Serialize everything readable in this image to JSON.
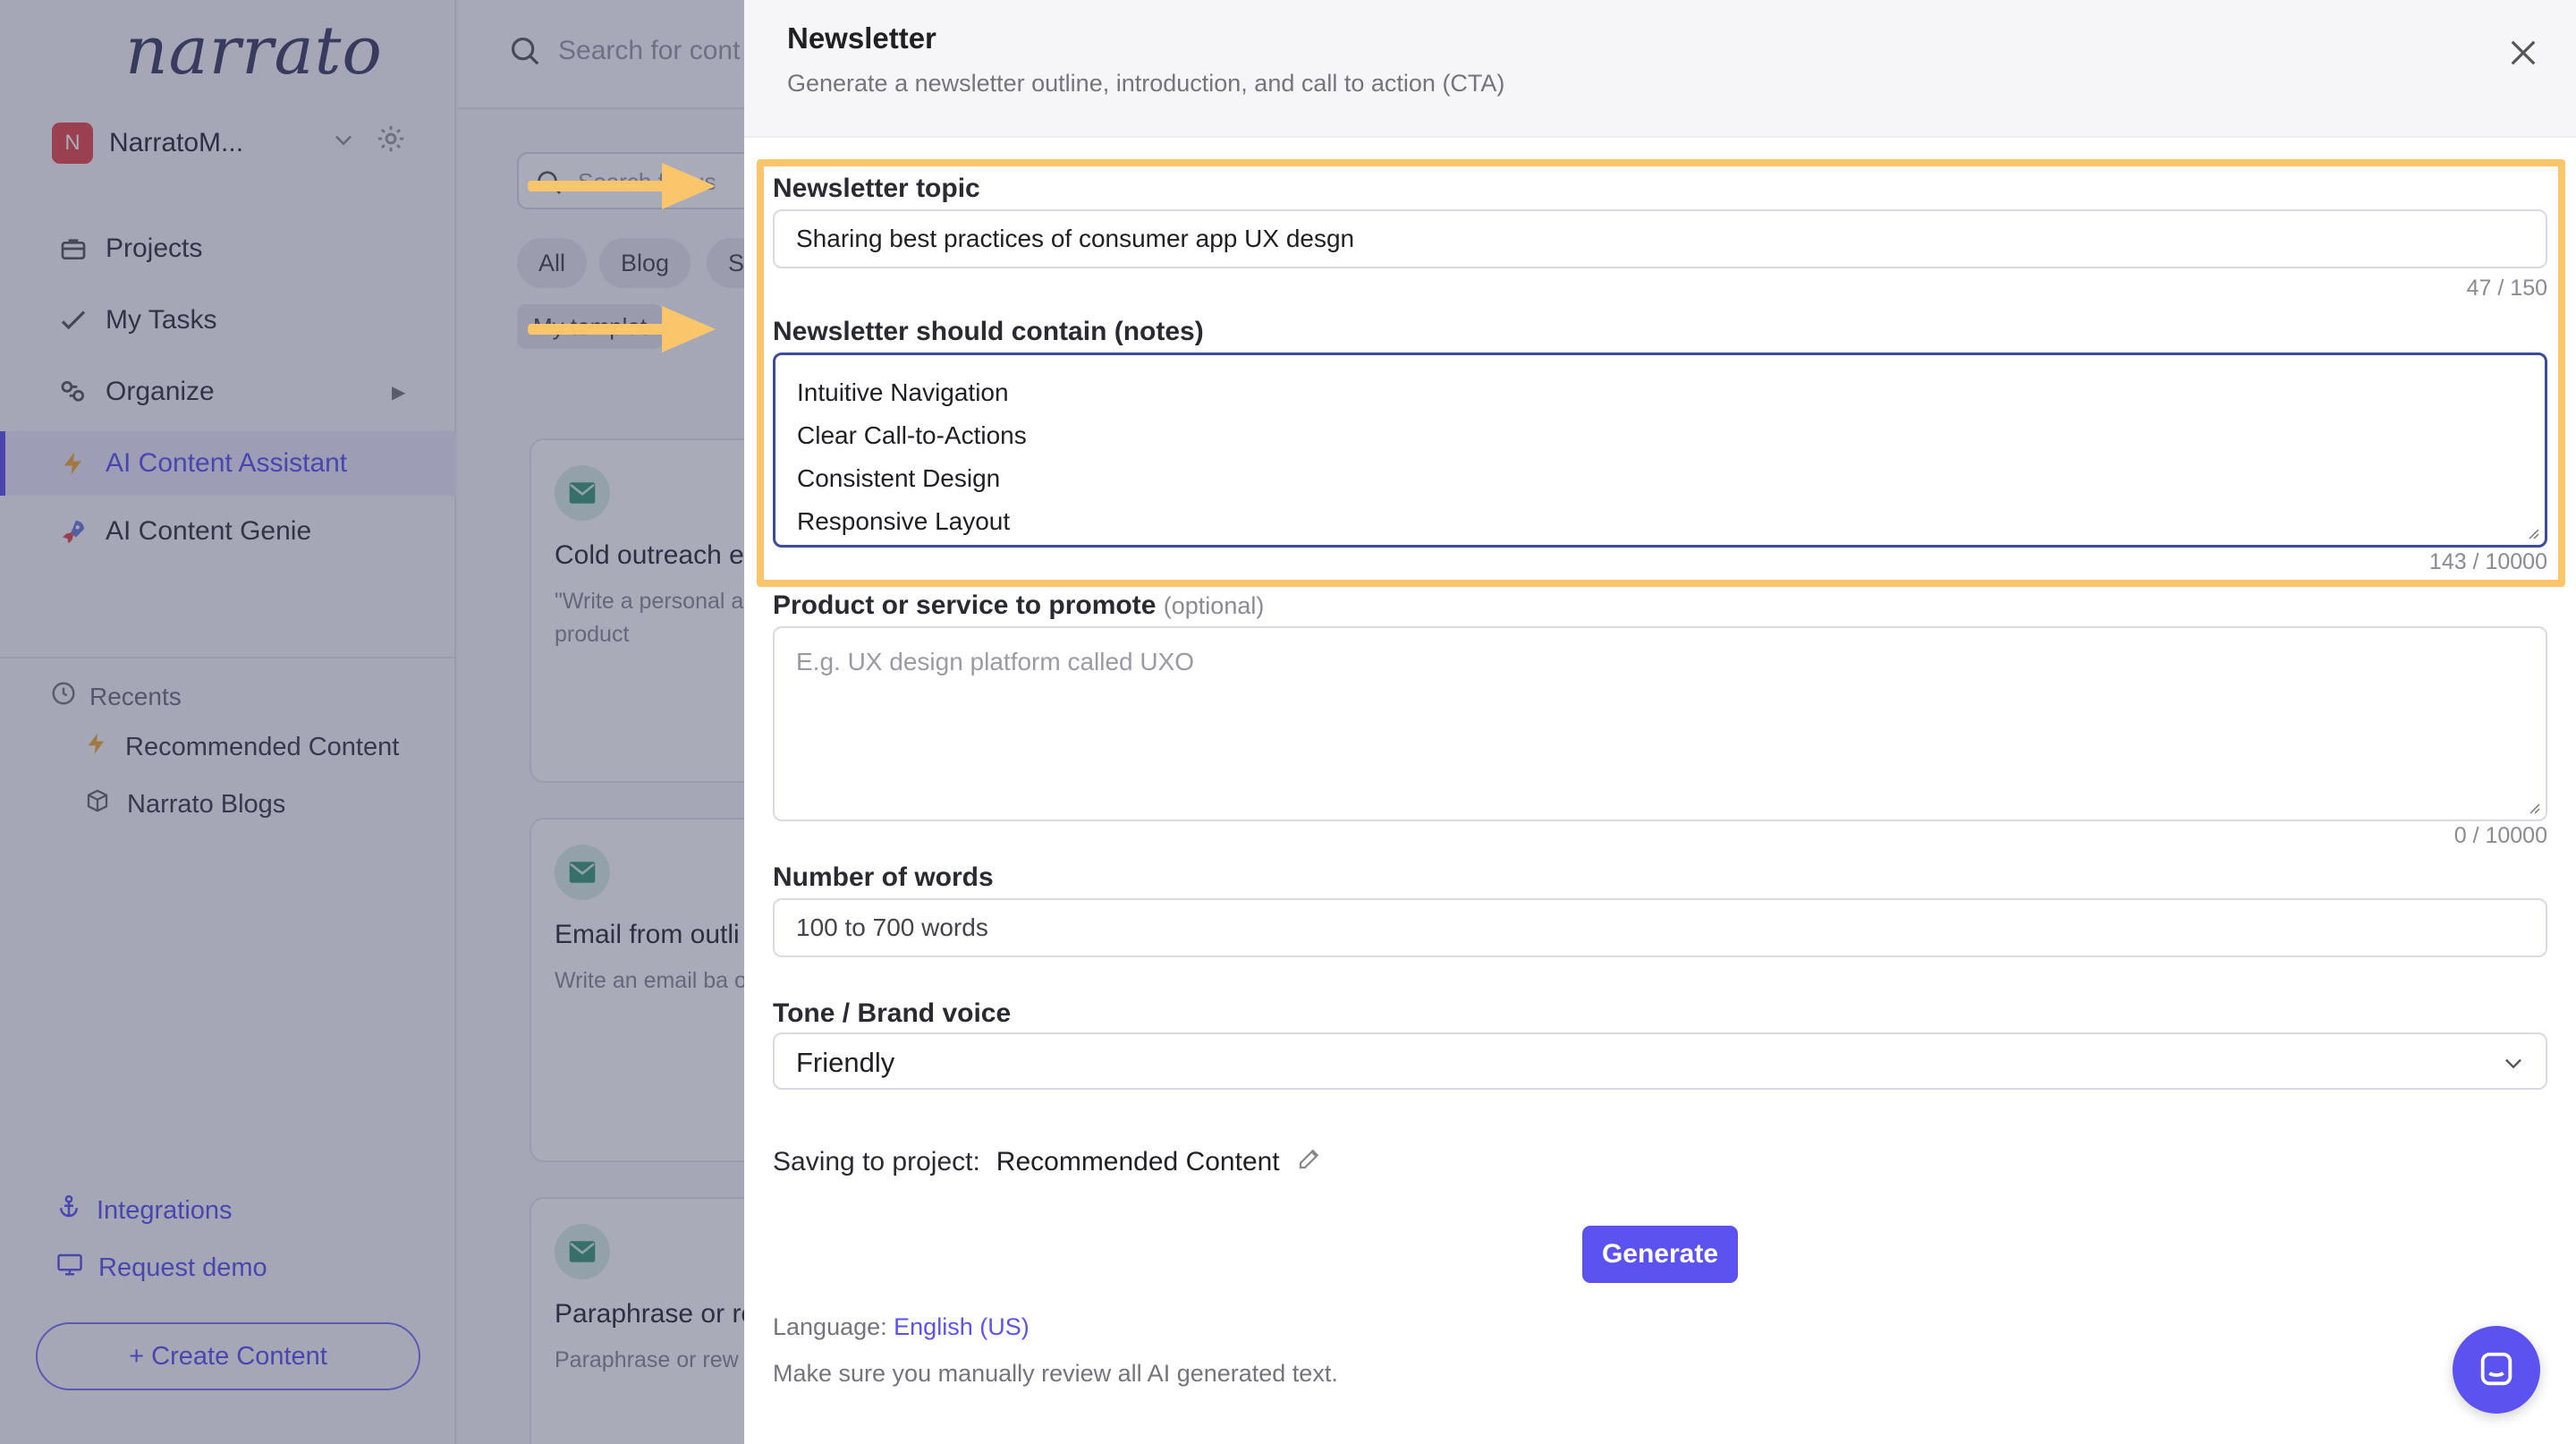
{
  "sidebar": {
    "logo": "narrato",
    "workspace": {
      "badge": "N",
      "name": "NarratoM..."
    },
    "nav": [
      {
        "label": "Projects",
        "icon": "briefcase-icon"
      },
      {
        "label": "My Tasks",
        "icon": "check-icon"
      },
      {
        "label": "Organize",
        "icon": "organize-icon"
      },
      {
        "label": "AI Content Assistant",
        "icon": "lightning-icon",
        "active": true
      },
      {
        "label": "AI Content Genie",
        "icon": "rocket-icon"
      }
    ],
    "recents_heading": "Recents",
    "recents": [
      {
        "label": "Recommended Content",
        "icon": "lightning-icon"
      },
      {
        "label": "Narrato Blogs",
        "icon": "cube-icon"
      }
    ],
    "integrations": "Integrations",
    "request_demo": "Request demo",
    "create_content": "+ Create Content"
  },
  "main": {
    "search_placeholder": "Search for cont",
    "template_search_placeholder": "Search for us",
    "chips": [
      "All",
      "Blog",
      "S"
    ],
    "my_templates": "My templat",
    "cards": [
      {
        "title": "Cold outreach e",
        "desc": "\"Write a personal a specific product"
      },
      {
        "title": "Email from outli",
        "desc": "Write an email ba outline"
      },
      {
        "title": "Paraphrase or re",
        "desc": "Paraphrase or rew"
      }
    ]
  },
  "drawer": {
    "title": "Newsletter",
    "subtitle": "Generate a newsletter outline, introduction, and call to action (CTA)",
    "topic": {
      "label": "Newsletter topic",
      "value": "Sharing best practices of consumer app UX desgn",
      "counter": "47 / 150"
    },
    "notes": {
      "label": "Newsletter should contain (notes)",
      "lines": [
        "Intuitive Navigation",
        "Clear Call-to-Actions",
        "Consistent Design",
        "Responsive Layout"
      ],
      "counter": "143 / 10000"
    },
    "product": {
      "label": "Product or service to promote",
      "optional": "(optional)",
      "placeholder": "E.g. UX design platform called UXO",
      "counter": "0 / 10000"
    },
    "words": {
      "label": "Number of words",
      "value": "100 to 700 words"
    },
    "tone": {
      "label": "Tone / Brand voice",
      "value": "Friendly"
    },
    "saving_label": "Saving to project:",
    "saving_project": "Recommended Content",
    "generate": "Generate",
    "language_label": "Language:",
    "language_value": "English (US)",
    "review_note": "Make sure you manually review all AI generated text."
  },
  "colors": {
    "accent": "#5b52f0",
    "highlight": "#fbc56c",
    "overlay": "#343858"
  }
}
